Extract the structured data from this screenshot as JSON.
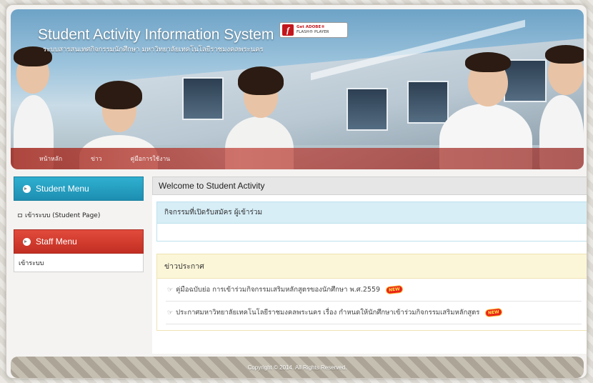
{
  "header": {
    "title": "Student Activity Information System",
    "subtitle": "ระบบสารสนเทศกิจกรรมนักศึกษา มหาวิทยาลัยเทคโนโลยีราชมงคลพระนคร",
    "flash_badge": {
      "line1": "Get ADOBE®",
      "line2": "FLASH® PLAYER"
    },
    "nav": [
      "หน้าหลัก",
      "ข่าว",
      "คู่มือการใช้งาน"
    ]
  },
  "sidebar": {
    "student_menu": {
      "title": "Student Menu",
      "items": [
        "เข้าระบบ (Student Page)"
      ]
    },
    "staff_menu": {
      "title": "Staff Menu",
      "items": [
        "เข้าระบบ"
      ]
    }
  },
  "main": {
    "welcome": "Welcome to Student Activity",
    "activities_header": "กิจกรรมที่เปิดรับสมัคร ผู้เข้าร่วม",
    "news_header": "ข่าวประกาศ",
    "news": [
      {
        "text": "คู่มือฉบับย่อ การเข้าร่วมกิจกรรมเสริมหลักสูตรของนักศึกษา พ.ศ.2559",
        "badge": "NEW"
      },
      {
        "text": "ประกาศมหาวิทยาลัยเทคโนโลยีราชมงคลพระนคร เรื่อง กำหนดให้นักศึกษาเข้าร่วมกิจกรรมเสริมหลักสูตร",
        "badge": "NEW"
      }
    ]
  },
  "footer": {
    "copyright": "Copyright © 2014. All Rights Reserved."
  },
  "colors": {
    "student_menu": "#1d8eb1",
    "staff_menu": "#c22e22",
    "nav_bar": "#a0281e"
  }
}
